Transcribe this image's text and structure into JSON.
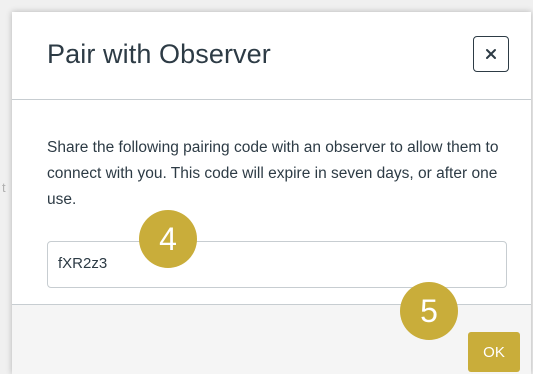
{
  "dialog": {
    "title": "Pair with Observer",
    "close_symbol": "×",
    "description": "Share the following pairing code with an observer to allow them to connect with you. This code will expire in seven days, or after one use.",
    "pairing_code": "fXR2z3",
    "ok_label": "OK"
  },
  "annotations": {
    "step_4": "4",
    "step_5": "5"
  },
  "background": {
    "edge_text": "t"
  },
  "colors": {
    "accent": "#c9ad3a",
    "text": "#2d3b45",
    "border": "#c7cdd1",
    "footer_bg": "#f5f5f5"
  },
  "icons": {
    "close": "close-icon"
  }
}
